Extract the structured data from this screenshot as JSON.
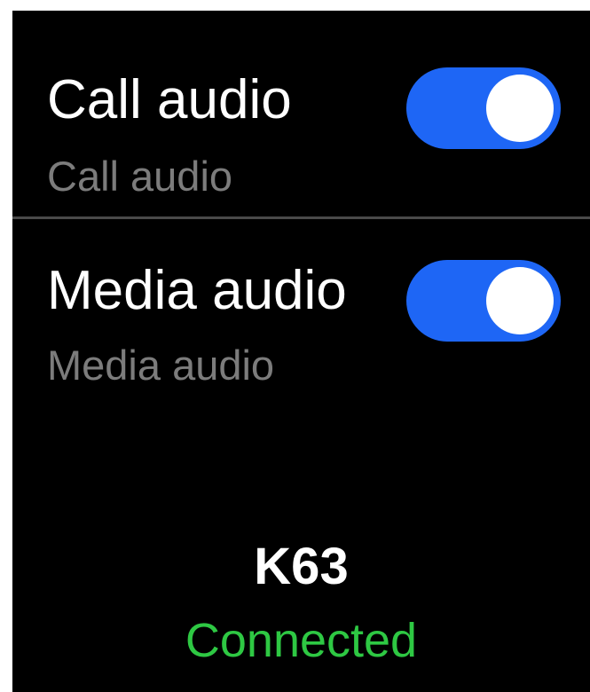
{
  "colors": {
    "background": "#000000",
    "toggle_on": "#1e66f5",
    "status_connected": "#2ec843",
    "subtitle": "#7c7c7c",
    "divider": "#4a4a4a"
  },
  "settings": {
    "items": [
      {
        "title": "Call audio",
        "subtitle": "Call audio",
        "enabled": true
      },
      {
        "title": "Media audio",
        "subtitle": "Media audio",
        "enabled": true
      }
    ]
  },
  "device": {
    "name": "K63",
    "status": "Connected"
  }
}
